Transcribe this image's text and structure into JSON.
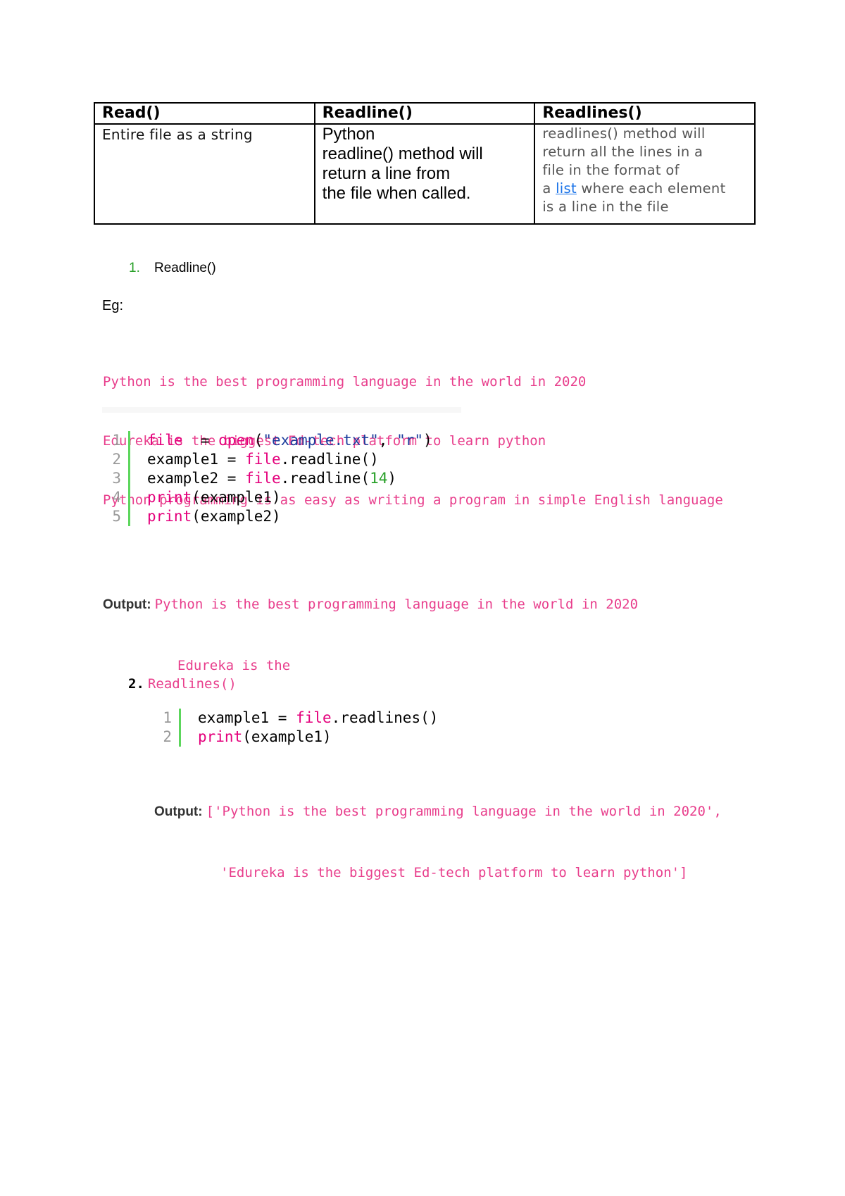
{
  "table": {
    "headers": [
      "Read()",
      "Readline()",
      "Readlines()"
    ],
    "read_desc": "Entire file as a string",
    "readline_desc_lines": [
      "Python",
      "readline() method will",
      "return a line from",
      "the file when called."
    ],
    "readlines_desc": {
      "line1": "readlines() method will",
      "line2": "return all the lines in a",
      "line3": "file in the format of",
      "line4_prefix": "a ",
      "line4_link": "list",
      "line4_suffix": " where each element",
      "line5": "is a line in the file"
    }
  },
  "section1": {
    "number": "1.",
    "title": "Readline()",
    "eg_label": "Eg:",
    "example_lines": [
      "Python is the best programming language in the world in 2020",
      "Edureka is the biggest Ed-tech platform to learn python",
      "Python programming is as easy as writing a program in simple English language"
    ],
    "code": [
      {
        "ln": "1",
        "parts": [
          [
            "kw",
            "file"
          ],
          [
            "",
            "  = "
          ],
          [
            "kw",
            "open"
          ],
          [
            "",
            "("
          ],
          [
            "str",
            "\"example.txt\""
          ],
          [
            "",
            ", "
          ],
          [
            "str",
            "\"r\""
          ],
          [
            "",
            ")"
          ]
        ]
      },
      {
        "ln": "2",
        "parts": [
          [
            "",
            "example1 = "
          ],
          [
            "kw",
            "file"
          ],
          [
            "",
            ".readline()"
          ]
        ]
      },
      {
        "ln": "3",
        "parts": [
          [
            "",
            "example2 = "
          ],
          [
            "kw",
            "file"
          ],
          [
            "",
            ".readline("
          ],
          [
            "num",
            "14"
          ],
          [
            "",
            ")"
          ]
        ]
      },
      {
        "ln": "4",
        "parts": [
          [
            "kw",
            "print"
          ],
          [
            "",
            "(example1)"
          ]
        ]
      },
      {
        "ln": "5",
        "parts": [
          [
            "kw",
            "print"
          ],
          [
            "",
            "(example2)"
          ]
        ]
      }
    ],
    "output_label": "Output:",
    "output_lines": [
      "Python is the best programming language in the world in 2020",
      "Edureka is the"
    ]
  },
  "section2": {
    "number": "2.",
    "title": "Readlines()",
    "code": [
      {
        "ln": "1",
        "parts": [
          [
            "",
            "example1 = "
          ],
          [
            "kw",
            "file"
          ],
          [
            "",
            ".readlines()"
          ]
        ]
      },
      {
        "ln": "2",
        "parts": [
          [
            "kw",
            "print"
          ],
          [
            "",
            "(example1)"
          ]
        ]
      }
    ],
    "output_label": "Output:",
    "output_lines": [
      "['Python is the best programming language in the world in 2020',",
      "'Edureka is the biggest Ed-tech platform to learn python']"
    ]
  },
  "colors": {
    "accent_pink": "#e83e8c",
    "keyword_pink": "#e4007c",
    "string_blue": "#1c3d9c",
    "number_green": "#28a028",
    "gutter_green": "#5cd65c",
    "link_blue": "#1a73e8"
  }
}
